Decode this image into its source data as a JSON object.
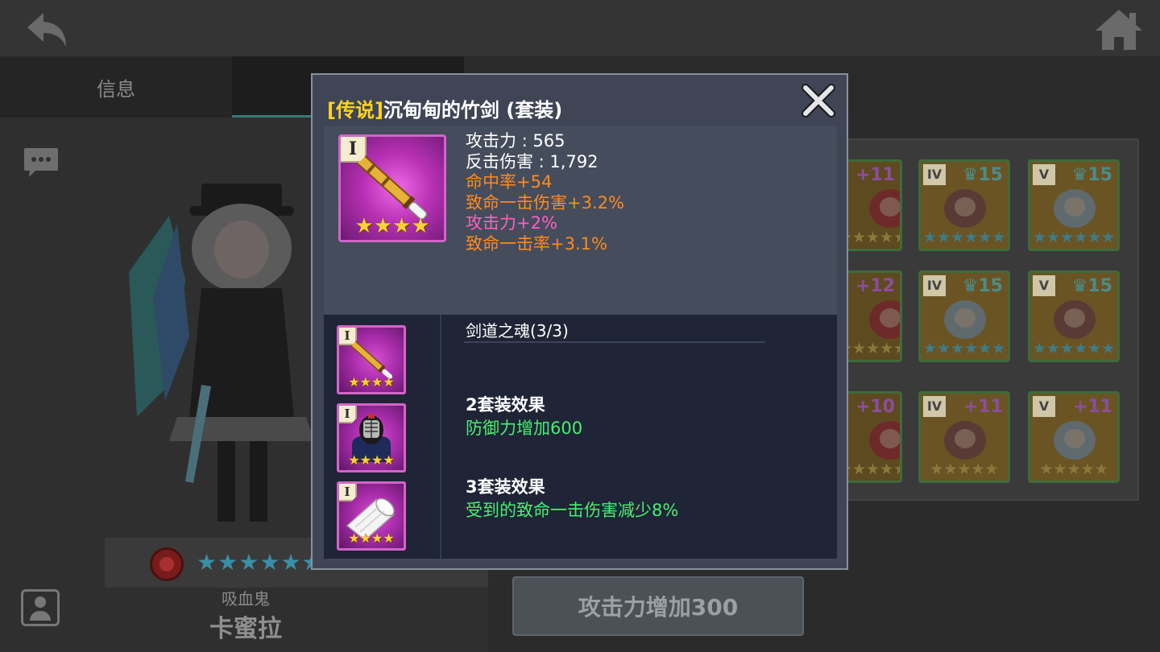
{
  "background": {
    "tabs": [
      "信息",
      ""
    ],
    "character": {
      "class_label": "吸血鬼",
      "name": "卡蜜拉",
      "star_count": 6
    },
    "grid": [
      {
        "rank": "",
        "level": "+11",
        "star_color": "gold"
      },
      {
        "rank": "IV",
        "level": "♛15",
        "star_color": "blue"
      },
      {
        "rank": "V",
        "level": "♛15",
        "star_color": "blue"
      },
      {
        "rank": "",
        "level": "+12",
        "star_color": "gold"
      },
      {
        "rank": "IV",
        "level": "♛15",
        "star_color": "blue"
      },
      {
        "rank": "V",
        "level": "♛15",
        "star_color": "blue"
      },
      {
        "rank": "",
        "level": "+10",
        "star_color": "gold"
      },
      {
        "rank": "IV",
        "level": "+11",
        "star_color": "gold"
      },
      {
        "rank": "V",
        "level": "+11",
        "star_color": "gold"
      }
    ],
    "bottom_button": "攻击力增加300"
  },
  "popup": {
    "title_grade": "[传说]",
    "title_name": "沉甸甸的竹剑 (套装)",
    "item": {
      "rank": "I",
      "star_count": 4,
      "stats": [
        {
          "text": "攻击力 : 565",
          "color": "white"
        },
        {
          "text": "反击伤害 : 1,792",
          "color": "white"
        },
        {
          "text": "命中率+54",
          "color": "orange"
        },
        {
          "text": "致命一击伤害+3.2%",
          "color": "orange"
        },
        {
          "text": "攻击力+2%",
          "color": "pink"
        },
        {
          "text": "致命一击率+3.1%",
          "color": "orange"
        }
      ]
    },
    "set": {
      "name": "剑道之魂(3/3)",
      "pieces": [
        {
          "rank": "I",
          "icon": "bamboo-sword-icon"
        },
        {
          "rank": "I",
          "icon": "kendo-helmet-icon"
        },
        {
          "rank": "I",
          "icon": "scroll-icon"
        }
      ],
      "bonus_2_label": "2套装效果",
      "bonus_2_text": "防御力增加600",
      "bonus_3_label": "3套装效果",
      "bonus_3_text": "受到的致命一击伤害减少8%"
    }
  },
  "colors": {
    "legend_grade": "#ffd31c",
    "stat_orange": "#ff8a1e",
    "stat_pink": "#ff5fc2",
    "set_green": "#46f070"
  }
}
